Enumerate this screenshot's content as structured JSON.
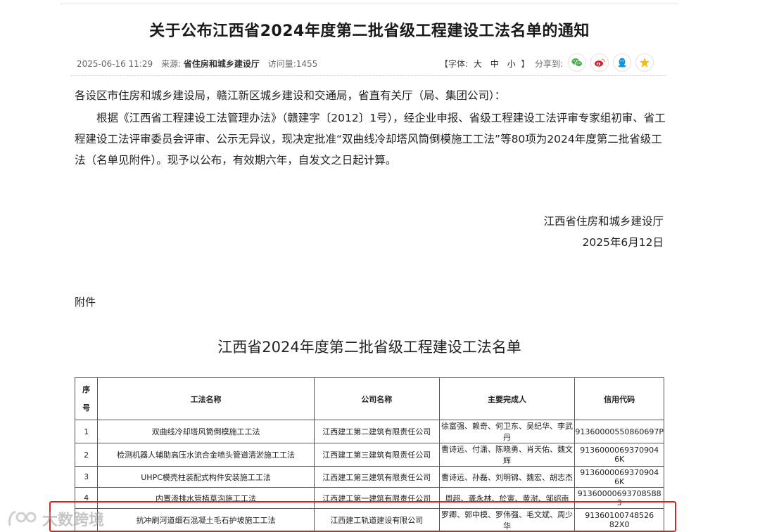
{
  "article": {
    "title": "关于公布江西省2024年度第二批省级工程建设工法名单的通知",
    "meta": {
      "date": "2025-06-16 11:29",
      "source_label": "来源:",
      "source_value": "省住房和城乡建设厅",
      "views_label": "访问量:",
      "views_value": "1455"
    },
    "font_size": {
      "label_open": "【字体:",
      "options": [
        "大",
        "中",
        "小"
      ],
      "label_close": "】"
    },
    "share_label": "分享到:",
    "share_icons": [
      "wechat-icon",
      "weibo-icon",
      "qq-icon",
      "qzone-icon"
    ],
    "colors": {
      "wechat": "#4cae4c",
      "weibo": "#e6162d",
      "qq": "#1296db",
      "qzone": "#f7b90f",
      "highlight": "#e02020"
    },
    "addressee": "各设区市住房和城乡建设局，赣江新区城乡建设和交通局，省直有关厅（局、集团公司）：",
    "body": "根据《江西省工程建设工法管理办法》（赣建字〔2012〕1号），经企业申报、省级工程建设工法评审专家组初审、省工程建设工法评审委员会评审、公示无异议，现决定批准“双曲线冷却塔风筒倒模施工工法”等80项为2024年度第二批省级工法（名单见附件）。现予以公布，有效期六年，自发文之日起计算。",
    "signature_org": "江西省住房和城乡建设厅",
    "signature_date": "2025年6月12日",
    "attachment_label": "附件"
  },
  "list": {
    "title": "江西省2024年度第二批省级工程建设工法名单",
    "headers": {
      "seq_top": "序",
      "seq_bottom": "号",
      "name": "工法名称",
      "company": "公司名称",
      "people": "主要完成人",
      "credit": "信用代码"
    },
    "rows": [
      {
        "seq": "1",
        "name": "双曲线冷却塔风筒倒模施工工法",
        "company": "江西建工第二建筑有限责任公司",
        "people": "徐富强、赖奇、何卫东、吴纪华、李武丹",
        "credit": "91360000550860697P"
      },
      {
        "seq": "2",
        "name": "检测机器人辅助高压水流合金喷头管道清淤施工工法",
        "company": "江西建工第三建筑有限责任公司",
        "people": "曹诗远、付潇、陈晓勇、肖天佑、魏文辉",
        "credit": "9136000069370904​6K"
      },
      {
        "seq": "3",
        "name": "UHPC模壳柱装配式构件安装施工工法",
        "company": "江西建工第三建筑有限责任公司",
        "people": "曹诗远、孙磊、刘明锦、魏宏、胡志杰",
        "credit": "9136000069370904​6K"
      },
      {
        "seq": "4",
        "name": "内置渗排水管植草沟施工工法",
        "company": "江西建工第一建筑有限责任公司",
        "people": "周超、龚永林、於寅、黄澍、邹绍南",
        "credit": "91360000693708588​3"
      },
      {
        "seq": "",
        "name": "抗冲刷河道细石混凝土毛石护坡施工工法",
        "company": "江西建工轨道建设有限公司",
        "people": "罗卿、郭中模、罗伟强、毛文斌、周少华",
        "credit": "91360100748526​82X0"
      }
    ]
  },
  "watermark": {
    "text": "大数跨境"
  }
}
